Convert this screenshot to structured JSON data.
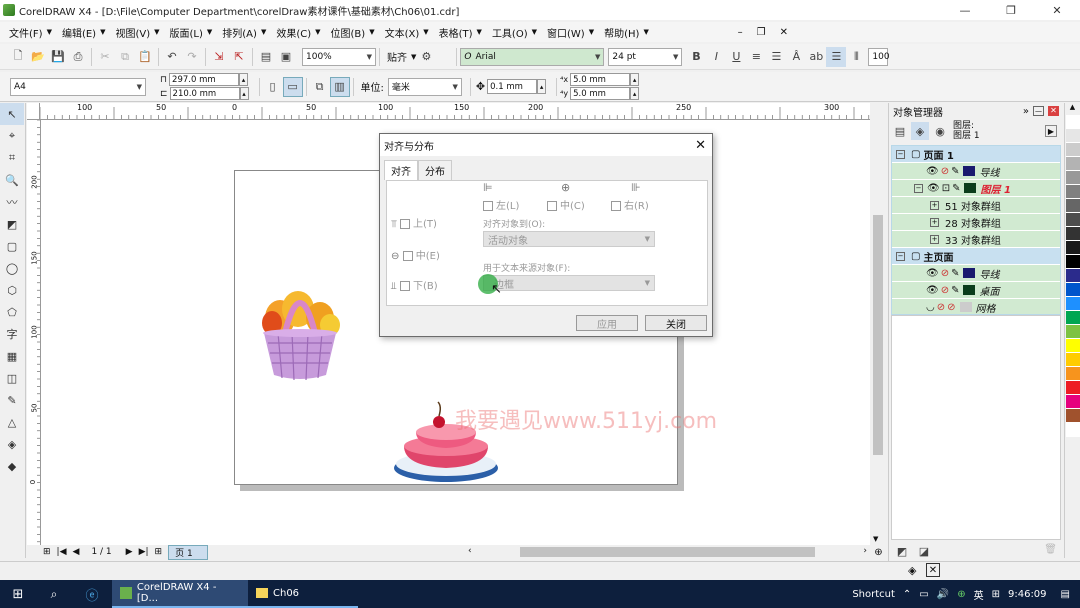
{
  "window": {
    "title": "CorelDRAW X4 - [D:\\File\\Computer Department\\corelDraw素材课件\\基础素材\\Ch06\\01.cdr]"
  },
  "menu": [
    {
      "label": "文件(F)"
    },
    {
      "label": "编辑(E)"
    },
    {
      "label": "视图(V)"
    },
    {
      "label": "版面(L)"
    },
    {
      "label": "排列(A)"
    },
    {
      "label": "效果(C)"
    },
    {
      "label": "位图(B)"
    },
    {
      "label": "文本(X)"
    },
    {
      "label": "表格(T)"
    },
    {
      "label": "工具(O)"
    },
    {
      "label": "窗口(W)"
    },
    {
      "label": "帮助(H)"
    }
  ],
  "toolbar": {
    "zoom": "100%",
    "snap_label": "贴齐",
    "font_name": "Arial",
    "font_size": "24 pt",
    "right_field": "100"
  },
  "property_bar": {
    "paper": "A4",
    "width": "297.0 mm",
    "height": "210.0 mm",
    "unit_label": "单位:",
    "unit": "毫米",
    "nudge": "0.1 mm",
    "dup_x": "5.0 mm",
    "dup_y": "5.0 mm"
  },
  "ruler": {
    "h_ticks": [
      "100",
      "50",
      "0",
      "50",
      "100",
      "150",
      "200",
      "250",
      "300"
    ],
    "v_ticks": [
      "200",
      "150",
      "100",
      "50",
      "0"
    ]
  },
  "canvas": {
    "watermark": "我要遇见www.511yj.com"
  },
  "page_nav": {
    "count": "1 / 1",
    "tab": "页 1"
  },
  "align_dialog": {
    "title": "对齐与分布",
    "tabs": [
      "对齐",
      "分布"
    ],
    "h_labels": [
      "左(L)",
      "中(C)",
      "右(R)"
    ],
    "v_labels": [
      "上(T)",
      "中(E)",
      "下(B)"
    ],
    "align_to_label": "对齐对象到(O):",
    "align_to_value": "活动对象",
    "text_source_label": "用于文本来源对象(F):",
    "text_source_value": "边框",
    "apply": "应用",
    "close": "关闭"
  },
  "object_manager": {
    "title": "对象管理器",
    "header_label": "图层:",
    "header_value": "图层 1",
    "rows": [
      {
        "label": "页面 1",
        "level": 0,
        "color": "",
        "bold": true
      },
      {
        "label": "导线",
        "level": 1,
        "color": "#1a1a6e",
        "bold": false
      },
      {
        "label": "图层 1",
        "level": 1,
        "color": "#0b3d1c",
        "bold": true,
        "red": true
      },
      {
        "label": "51 对象群组",
        "level": 2,
        "color": "",
        "bold": false
      },
      {
        "label": "28 对象群组",
        "level": 2,
        "color": "",
        "bold": false
      },
      {
        "label": "33 对象群组",
        "level": 2,
        "color": "",
        "bold": false
      },
      {
        "label": "主页面",
        "level": 0,
        "color": "",
        "bold": true
      },
      {
        "label": "导线",
        "level": 1,
        "color": "#1a1a6e",
        "bold": false
      },
      {
        "label": "桌面",
        "level": 1,
        "color": "#0b3d1c",
        "bold": false
      },
      {
        "label": "网格",
        "level": 1,
        "color": "#cccccc",
        "bold": false
      }
    ]
  },
  "palette": [
    "#ffffff",
    "#e6e6e6",
    "#cccccc",
    "#b3b3b3",
    "#999999",
    "#808080",
    "#666666",
    "#4d4d4d",
    "#333333",
    "#1a1a1a",
    "#000000",
    "#2b2b8c",
    "#0055cc",
    "#1e90ff",
    "#00a651",
    "#7dc242",
    "#ffff00",
    "#ffcc00",
    "#f7941d",
    "#ed1c24",
    "#e6007e",
    "#a0522d",
    "#ffffff"
  ],
  "taskbar": {
    "app1": "CorelDRAW X4 - [D...",
    "app2": "Ch06",
    "shortcut": "Shortcut",
    "ime": "英",
    "time": "9:46:09"
  }
}
